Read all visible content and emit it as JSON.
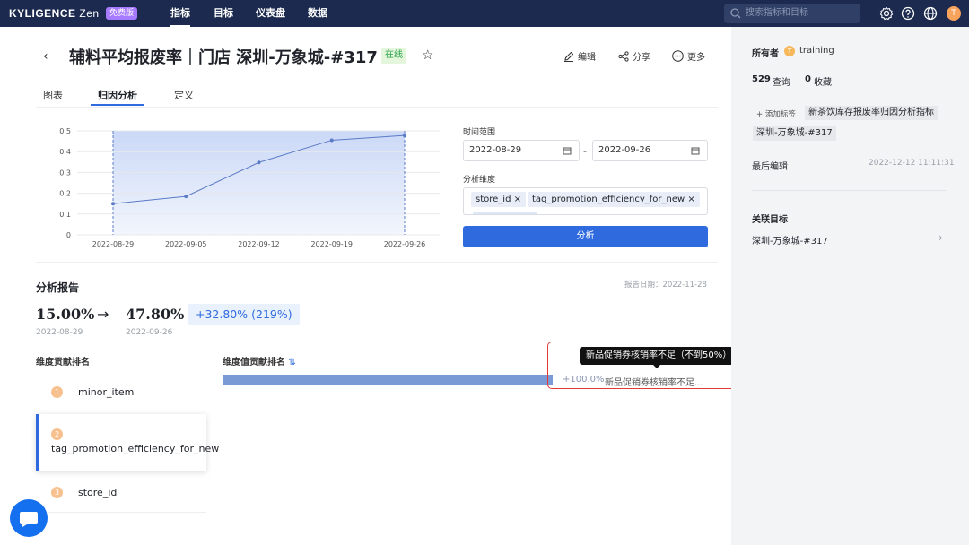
{
  "topbar": {
    "brand": "KYLIGENCE",
    "brand_suffix": "Zen",
    "plan_badge": "免费版",
    "nav": [
      "指标",
      "目标",
      "仪表盘",
      "数据"
    ],
    "search_placeholder": "搜索指标和目标",
    "avatar_letter": "T",
    "icons": [
      "settings-icon",
      "help-icon",
      "globe-icon"
    ]
  },
  "header": {
    "title": "辅料平均报废率｜门店 深圳-万象城-#317",
    "status": "在线",
    "actions": [
      "编辑",
      "分享",
      "更多"
    ]
  },
  "tabs": [
    "图表",
    "归因分析",
    "定义"
  ],
  "active_tab": "归因分析",
  "form": {
    "time_range_label": "时间范围",
    "start_date": "2022-08-29",
    "end_date": "2022-09-26",
    "range_sep": "-",
    "dimension_label": "分析维度",
    "dimensions": [
      "store_id",
      "tag_promotion_efficiency_for_new"
    ],
    "analyze_button": "分析"
  },
  "chart_data": {
    "type": "area",
    "x": [
      "2022-08-29",
      "2022-09-05",
      "2022-09-12",
      "2022-09-19",
      "2022-09-26"
    ],
    "values": [
      0.15,
      0.185,
      0.348,
      0.455,
      0.478
    ],
    "yticks": [
      "0",
      "0.1",
      "0.2",
      "0.3",
      "0.4",
      "0.5"
    ],
    "ylim": [
      0,
      0.5
    ],
    "grid": true,
    "color": "#5b86e5"
  },
  "report": {
    "title": "分析报告",
    "date_text": "报告日期：2022-11-28",
    "from_value": "15.00%",
    "from_date": "2022-08-29",
    "to_value": "47.80%",
    "to_date": "2022-09-26",
    "arrow": "→",
    "delta": "+32.80% (219%)",
    "dim_rank_title": "维度贡献排名",
    "value_rank_title": "维度值贡献排名",
    "sort_icon": "⇅",
    "ranks": [
      {
        "num": "1",
        "label": "minor_item"
      },
      {
        "num": "2",
        "label": "tag_promotion_efficiency_for_new"
      },
      {
        "num": "3",
        "label": "store_id"
      }
    ],
    "bar_share": 1.0,
    "bar_pct": "+100.0%",
    "bar_label": "新品促销券核销率不足...",
    "tooltip": "新品促销券核销率不足（不到50%）"
  },
  "side": {
    "owner_label": "所有者",
    "owner_avatar": "T",
    "owner_name": "training",
    "query_count": "529",
    "query_label": "查询",
    "fav_count": "0",
    "fav_label": "收藏",
    "add_tag": "+ 添加标签",
    "tags": [
      "新茶饮库存报废率归因分析指标",
      "深圳-万象城-#317"
    ],
    "last_edit_label": "最后编辑",
    "last_edit_time": "2022-12-12 11:11:31",
    "related_title": "关联目标",
    "related_item": "深圳-万象城-#317"
  }
}
